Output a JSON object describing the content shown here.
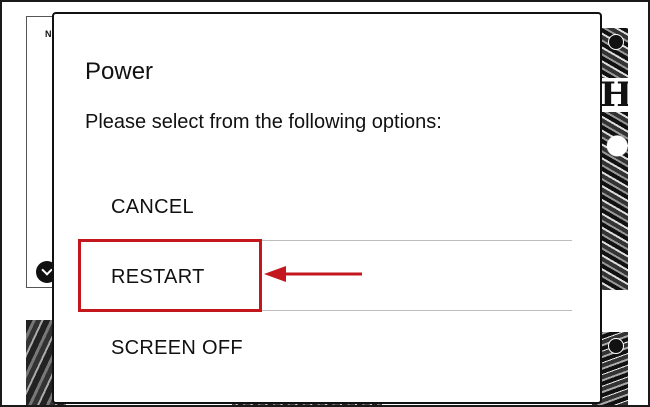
{
  "background": {
    "cover_left_mark": "N",
    "cover_right_mark": "H"
  },
  "dialog": {
    "title": "Power",
    "message": "Please select from the following options:",
    "options": [
      {
        "label": "CANCEL"
      },
      {
        "label": "RESTART"
      },
      {
        "label": "SCREEN OFF"
      }
    ]
  },
  "annotation": {
    "highlighted_option": "RESTART",
    "color": "#c4171d"
  },
  "colors": {
    "text": "#111111",
    "divider": "#bdbdbd",
    "background": "#ffffff"
  }
}
